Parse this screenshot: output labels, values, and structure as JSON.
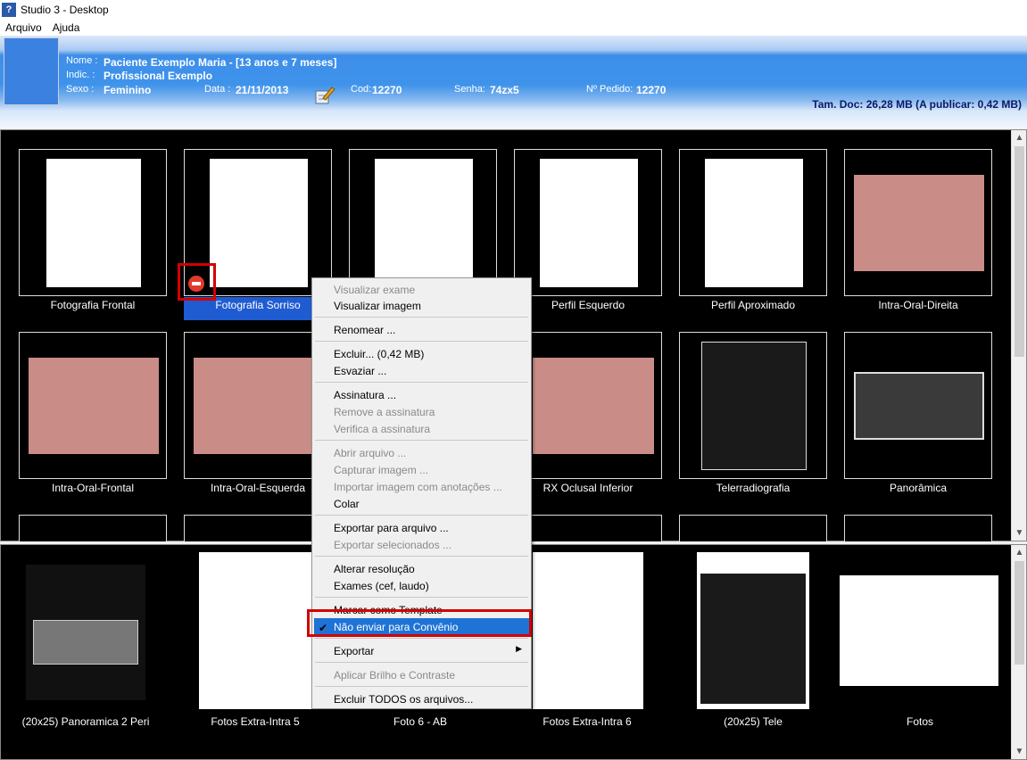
{
  "window": {
    "title": "Studio 3 - Desktop",
    "icon": "app-icon"
  },
  "menubar": {
    "items": [
      "Arquivo",
      "Ajuda"
    ]
  },
  "patient": {
    "nome_label": "Nome :",
    "nome": "Paciente Exemplo Maria - [13 anos e 7 meses]",
    "indic_label": "Indic. :",
    "indic": "Profissional Exemplo",
    "sexo_label": "Sexo :",
    "sexo": "Feminino",
    "data_label": "Data :",
    "data": "21/11/2013",
    "cod_label": "Cod:",
    "cod": "12270",
    "senha_label": "Senha:",
    "senha": "74zx5",
    "pedido_label": "Nº Pedido:",
    "pedido": "12270",
    "tam_doc": "Tam. Doc: 26,28 MB (A publicar: 0,42 MB)"
  },
  "top_grid": {
    "row1": [
      "Fotografia Frontal",
      "Fotografia Sorriso",
      "",
      "Perfil Esquerdo",
      "Perfil Aproximado",
      "Intra-Oral-Direita"
    ],
    "row2": [
      "Intra-Oral-Frontal",
      "Intra-Oral-Esquerda",
      "",
      "RX Oclusal Inferior",
      "Telerradiografia",
      "Panorâmica"
    ]
  },
  "bottom_row": [
    "(20x25) Panoramica 2 Peri",
    "Fotos Extra-Intra 5",
    "Foto 6 - AB",
    "Fotos Extra-Intra 6",
    "(20x25) Tele",
    "Fotos"
  ],
  "context_menu": {
    "items": [
      {
        "label": "Visualizar exame",
        "enabled": false
      },
      {
        "label": "Visualizar imagem",
        "enabled": true
      },
      {
        "label": "Renomear ...",
        "enabled": true
      },
      {
        "label": "Excluir... (0,42 MB)",
        "enabled": true
      },
      {
        "label": "Esvaziar ...",
        "enabled": true
      },
      {
        "label": "Assinatura ...",
        "enabled": true
      },
      {
        "label": "Remove a assinatura",
        "enabled": false
      },
      {
        "label": "Verifica a assinatura",
        "enabled": false
      },
      {
        "label": "Abrir arquivo ...",
        "enabled": false
      },
      {
        "label": "Capturar imagem ...",
        "enabled": false
      },
      {
        "label": "Importar imagem com anotações ...",
        "enabled": false
      },
      {
        "label": "Colar",
        "enabled": true
      },
      {
        "label": "Exportar para arquivo ...",
        "enabled": true
      },
      {
        "label": "Exportar selecionados ...",
        "enabled": false
      },
      {
        "label": "Alterar resolução",
        "enabled": true
      },
      {
        "label": "Exames (cef, laudo)",
        "enabled": true
      },
      {
        "label": "Marcar como Template",
        "enabled": true
      },
      {
        "label": "Não enviar para Convênio",
        "enabled": true,
        "checked": true,
        "highlighted": true
      },
      {
        "label": "Exportar",
        "enabled": true,
        "submenu": true
      },
      {
        "label": "Aplicar Brilho e Contraste",
        "enabled": false
      },
      {
        "label": "Excluir TODOS os arquivos...",
        "enabled": true
      }
    ]
  },
  "colors": {
    "header_blue": "#3f93ea",
    "selection": "#1f73d6",
    "annotation_red": "#d40000"
  }
}
